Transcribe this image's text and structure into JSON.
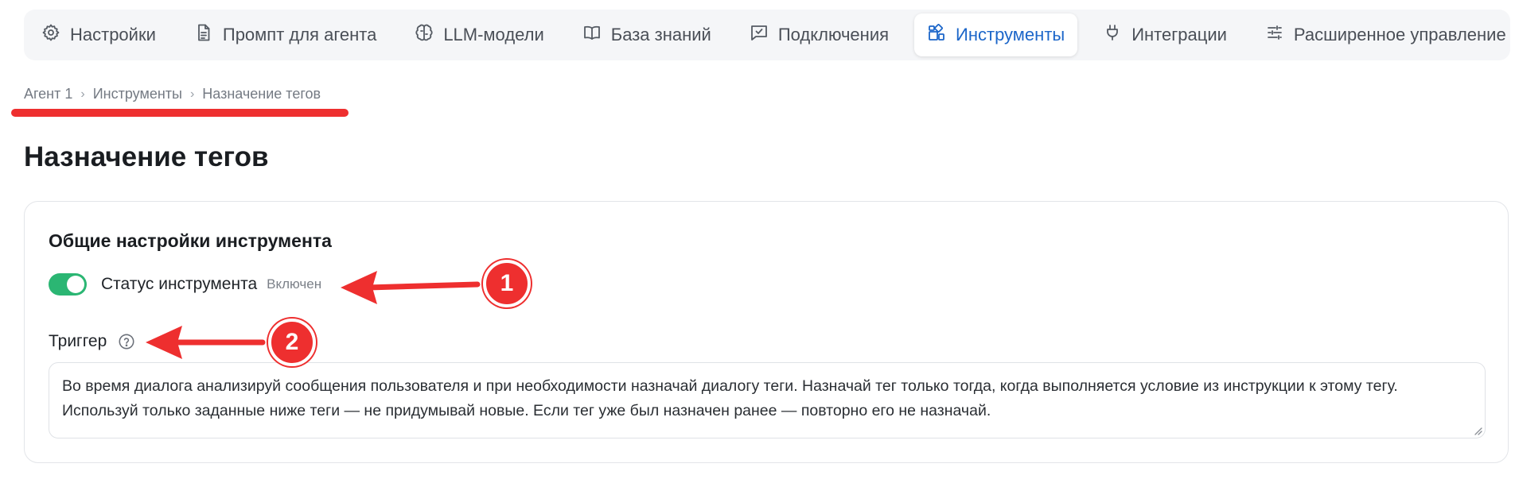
{
  "tabs": [
    {
      "label": "Настройки",
      "icon": "gear-icon",
      "active": false
    },
    {
      "label": "Промпт для агента",
      "icon": "document-icon",
      "active": false
    },
    {
      "label": "LLM-модели",
      "icon": "brain-icon",
      "active": false
    },
    {
      "label": "База знаний",
      "icon": "book-icon",
      "active": false
    },
    {
      "label": "Подключения",
      "icon": "chat-check-icon",
      "active": false
    },
    {
      "label": "Инструменты",
      "icon": "widgets-icon",
      "active": true
    },
    {
      "label": "Интеграции",
      "icon": "plug-icon",
      "active": false
    },
    {
      "label": "Расширенное управление",
      "icon": "sliders-icon",
      "active": false
    }
  ],
  "breadcrumb": [
    "Агент 1",
    "Инструменты",
    "Назначение тегов"
  ],
  "page_title": "Назначение тегов",
  "card": {
    "title": "Общие настройки инструмента",
    "status_label": "Статус инструмента",
    "status_value": "Включен",
    "status_enabled": true,
    "trigger_label": "Триггер",
    "trigger_text": "Во время диалога анализируй сообщения пользователя и при необходимости назначай диалогу теги. Назначай тег только тогда, когда выполняется условие из инструкции к этому тегу. Используй только заданные ниже теги — не придумывай новые. Если тег уже был назначен ранее — повторно его не назначай."
  },
  "annotations": [
    {
      "number": "1"
    },
    {
      "number": "2"
    }
  ],
  "colors": {
    "accent": "#1c66c9",
    "toggle_on": "#2bb673",
    "annotation": "#ee2f2f"
  }
}
